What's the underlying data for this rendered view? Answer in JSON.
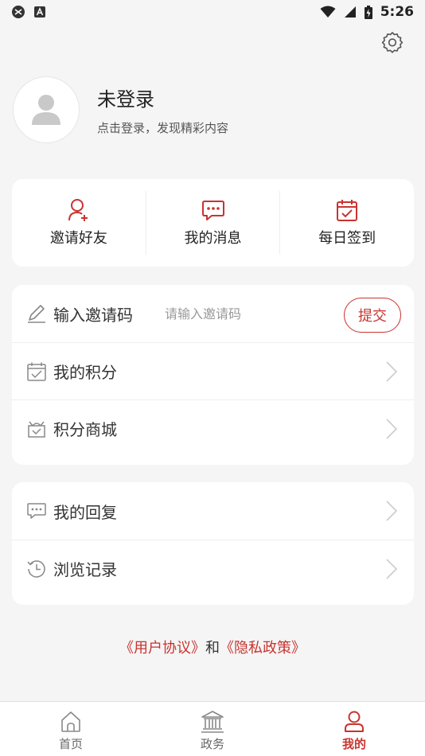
{
  "status_bar": {
    "time": "5:26"
  },
  "profile": {
    "name": "未登录",
    "subtitle": "点击登录，发现精彩内容"
  },
  "quick_actions": [
    {
      "label": "邀请好友",
      "icon": "add-user-icon"
    },
    {
      "label": "我的消息",
      "icon": "message-icon"
    },
    {
      "label": "每日签到",
      "icon": "calendar-check-icon"
    }
  ],
  "invite": {
    "label": "输入邀请码",
    "placeholder": "请输入邀请码",
    "submit_label": "提交"
  },
  "menu_group1": [
    {
      "label": "我的积分",
      "icon": "calendar-check-icon"
    },
    {
      "label": "积分商城",
      "icon": "gift-box-icon"
    }
  ],
  "menu_group2": [
    {
      "label": "我的回复",
      "icon": "chat-icon"
    },
    {
      "label": "浏览记录",
      "icon": "history-icon"
    }
  ],
  "agreement": {
    "user_agreement": "《用户协议》",
    "and": "和",
    "privacy_policy": "《隐私政策》"
  },
  "tabs": [
    {
      "label": "首页",
      "icon": "home-icon",
      "active": false
    },
    {
      "label": "政务",
      "icon": "government-building-icon",
      "active": false
    },
    {
      "label": "我的",
      "icon": "user-icon",
      "active": true
    }
  ],
  "colors": {
    "accent": "#c8342f",
    "background": "#f5f5f5"
  }
}
